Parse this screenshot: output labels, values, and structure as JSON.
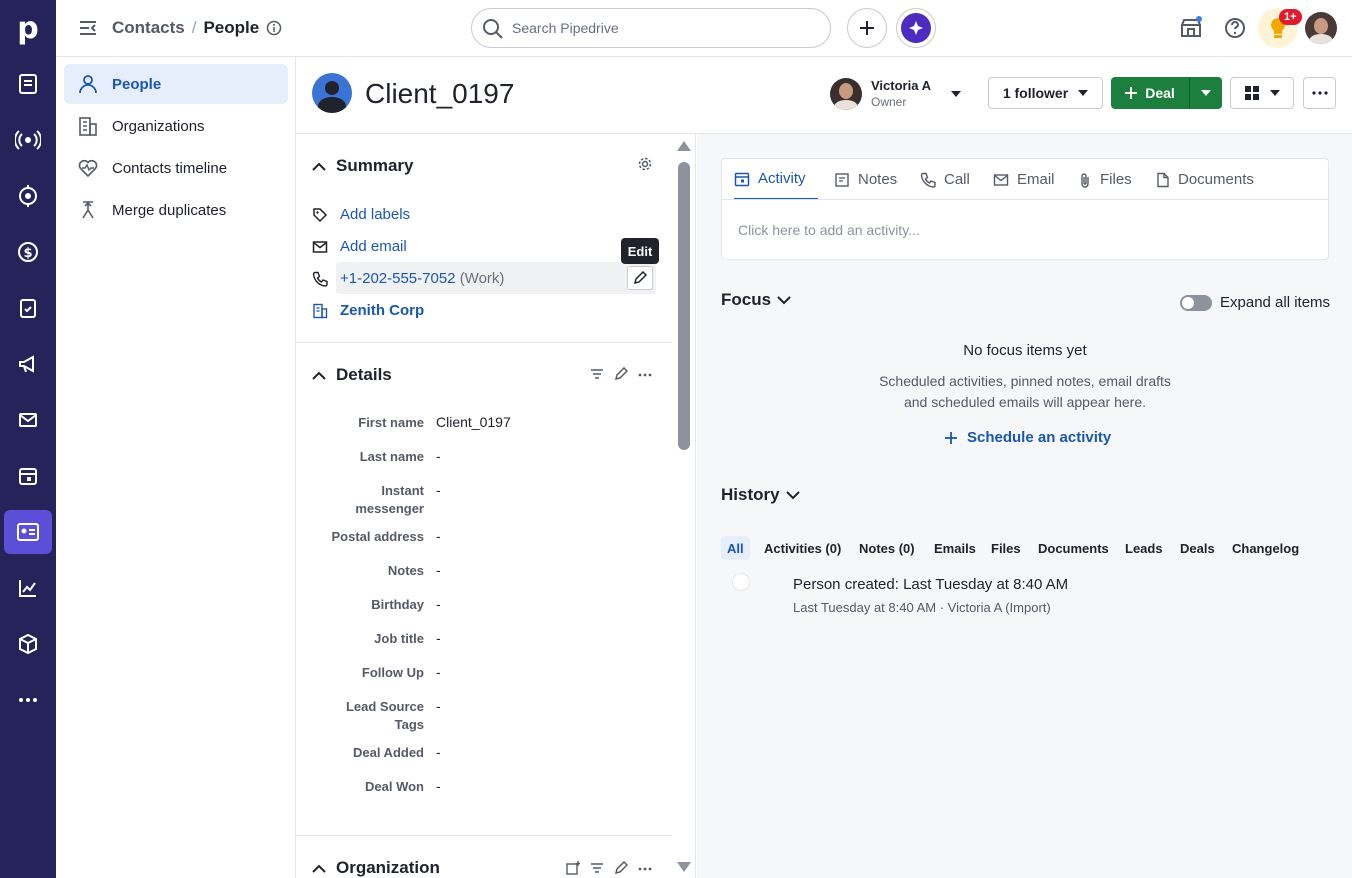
{
  "app": {
    "logo": "p"
  },
  "breadcrumb": {
    "parent": "Contacts",
    "separator": "/",
    "current": "People"
  },
  "search": {
    "placeholder": "Search Pipedrive"
  },
  "notifications": {
    "badge": "1+"
  },
  "sidenav": {
    "items": [
      {
        "label": "People",
        "icon": "person-icon",
        "active": true
      },
      {
        "label": "Organizations",
        "icon": "building-icon"
      },
      {
        "label": "Contacts timeline",
        "icon": "heart-pulse-icon"
      },
      {
        "label": "Merge duplicates",
        "icon": "merge-icon"
      }
    ]
  },
  "person": {
    "name": "Client_0197"
  },
  "owner": {
    "name": "Victoria A",
    "role": "Owner"
  },
  "actions": {
    "follower_label": "1 follower",
    "deal_label": "Deal"
  },
  "summary": {
    "title": "Summary",
    "add_labels": "Add labels",
    "add_email": "Add email",
    "phone": "+1-202-555-7052",
    "phone_type": "(Work)",
    "organization": "Zenith Corp",
    "edit_tooltip": "Edit"
  },
  "details": {
    "title": "Details",
    "fields": [
      {
        "label": "First name",
        "value": "Client_0197"
      },
      {
        "label": "Last name",
        "value": "-"
      },
      {
        "label": "Instant messenger",
        "value": "-"
      },
      {
        "label": "Postal address",
        "value": "-"
      },
      {
        "label": "Notes",
        "value": "-"
      },
      {
        "label": "Birthday",
        "value": "-"
      },
      {
        "label": "Job title",
        "value": "-"
      },
      {
        "label": "Follow Up",
        "value": "-"
      },
      {
        "label": "Lead Source Tags",
        "value": "-"
      },
      {
        "label": "Deal Added",
        "value": "-"
      },
      {
        "label": "Deal Won",
        "value": "-"
      }
    ]
  },
  "organization_section": {
    "title": "Organization"
  },
  "activity_tabs": {
    "tabs": [
      "Activity",
      "Notes",
      "Call",
      "Email",
      "Files",
      "Documents"
    ],
    "placeholder": "Click here to add an activity..."
  },
  "focus": {
    "title": "Focus",
    "expand_label": "Expand all items",
    "empty_title": "No focus items yet",
    "empty_text_1": "Scheduled activities, pinned notes, email drafts",
    "empty_text_2": "and scheduled emails will appear here.",
    "schedule_label": "Schedule an activity"
  },
  "history": {
    "title": "History",
    "filters": [
      "All",
      "Activities (0)",
      "Notes (0)",
      "Emails",
      "Files",
      "Documents",
      "Leads",
      "Deals",
      "Changelog"
    ],
    "entry_title": "Person created",
    "entry_time": "Last Tuesday at 8:40 AM",
    "entry_meta": "Last Tuesday at 8:40 AM · Victoria A (Import)"
  },
  "colors": {
    "rail": "#26235a",
    "accent": "#1a57b0",
    "deal_green": "#1c7f3d",
    "active_rail": "#5a4fd6"
  }
}
